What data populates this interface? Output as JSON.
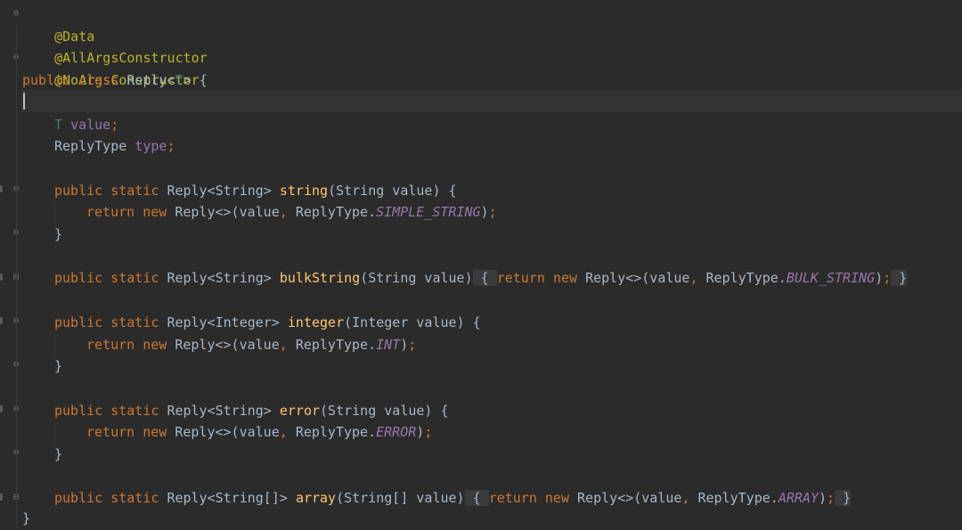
{
  "code": {
    "ann_data": "@Data",
    "ann_allargs": "@AllArgsConstructor",
    "ann_noargs": "@NoArgsConstructor",
    "kw_public": "public",
    "kw_class": "class",
    "kw_static": "static",
    "kw_return": "return",
    "kw_new": "new",
    "class_name": "Reply",
    "type_param": "T",
    "field_value": "value",
    "field_type_name": "ReplyType",
    "field_type": "type",
    "m_string": {
      "ret": "Reply<String>",
      "name": "string",
      "params": "(String value)",
      "body_new": "Reply<>(value",
      "body_enum_prefix": "ReplyType.",
      "enum": "SIMPLE_STRING"
    },
    "m_bulk": {
      "ret": "Reply<String>",
      "name": "bulkString",
      "params": "(String value)",
      "body_new": "Reply<>(value",
      "body_enum_prefix": "ReplyType.",
      "enum": "BULK_STRING"
    },
    "m_integer": {
      "ret": "Reply<Integer>",
      "name": "integer",
      "params": "(Integer value)",
      "body_new": "Reply<>(value",
      "body_enum_prefix": "ReplyType.",
      "enum": "INT"
    },
    "m_error": {
      "ret": "Reply<String>",
      "name": "error",
      "params": "(String value)",
      "body_new": "Reply<>(value",
      "body_enum_prefix": "ReplyType.",
      "enum": "ERROR"
    },
    "m_array": {
      "ret": "Reply<String[]>",
      "name": "array",
      "params": "(String[] value)",
      "body_new": "Reply<>(value",
      "body_enum_prefix": "ReplyType.",
      "enum": "ARRAY"
    },
    "open_brace": "{",
    "close_brace": "}",
    "close_paren_semi": ");",
    "comma": ",",
    "semi": ";",
    "lt": "<",
    "gt": ">"
  },
  "colors": {
    "background": "#2b2b2b",
    "keyword": "#cc7832",
    "annotation": "#bbb529",
    "text": "#a9b7c6",
    "field": "#9876aa",
    "method": "#ffc66d"
  },
  "icons": [
    "fold-open-icon",
    "fold-close-icon",
    "fold-expand-icon"
  ]
}
